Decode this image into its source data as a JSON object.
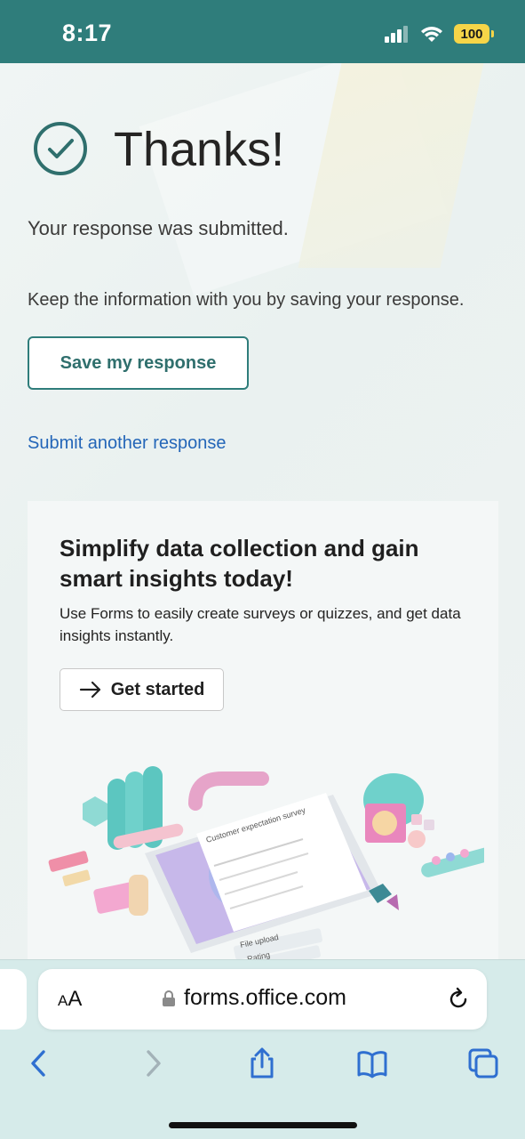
{
  "status_bar": {
    "time": "8:17",
    "battery": "100"
  },
  "confirmation": {
    "title": "Thanks!",
    "submitted": "Your response was submitted.",
    "keep_info": "Keep the information with you by saving your response.",
    "save_button": "Save my response",
    "submit_another": "Submit another response"
  },
  "promo": {
    "title": "Simplify data collection and gain smart insights today!",
    "description": "Use Forms to easily create surveys or quizzes, and get data insights instantly.",
    "button": "Get started",
    "illustration": {
      "survey_title": "Customer expectation survey",
      "chip_1": "File upload",
      "chip_2": "Rating"
    }
  },
  "browser": {
    "text_size_label_small": "A",
    "text_size_label_large": "A",
    "url": "forms.office.com",
    "toolbar_icons": [
      "back-icon",
      "forward-icon",
      "share-icon",
      "bookmarks-icon",
      "tabs-icon"
    ]
  },
  "colors": {
    "accent": "#2f7d7b",
    "link": "#2466b8",
    "battery": "#f6d548"
  }
}
